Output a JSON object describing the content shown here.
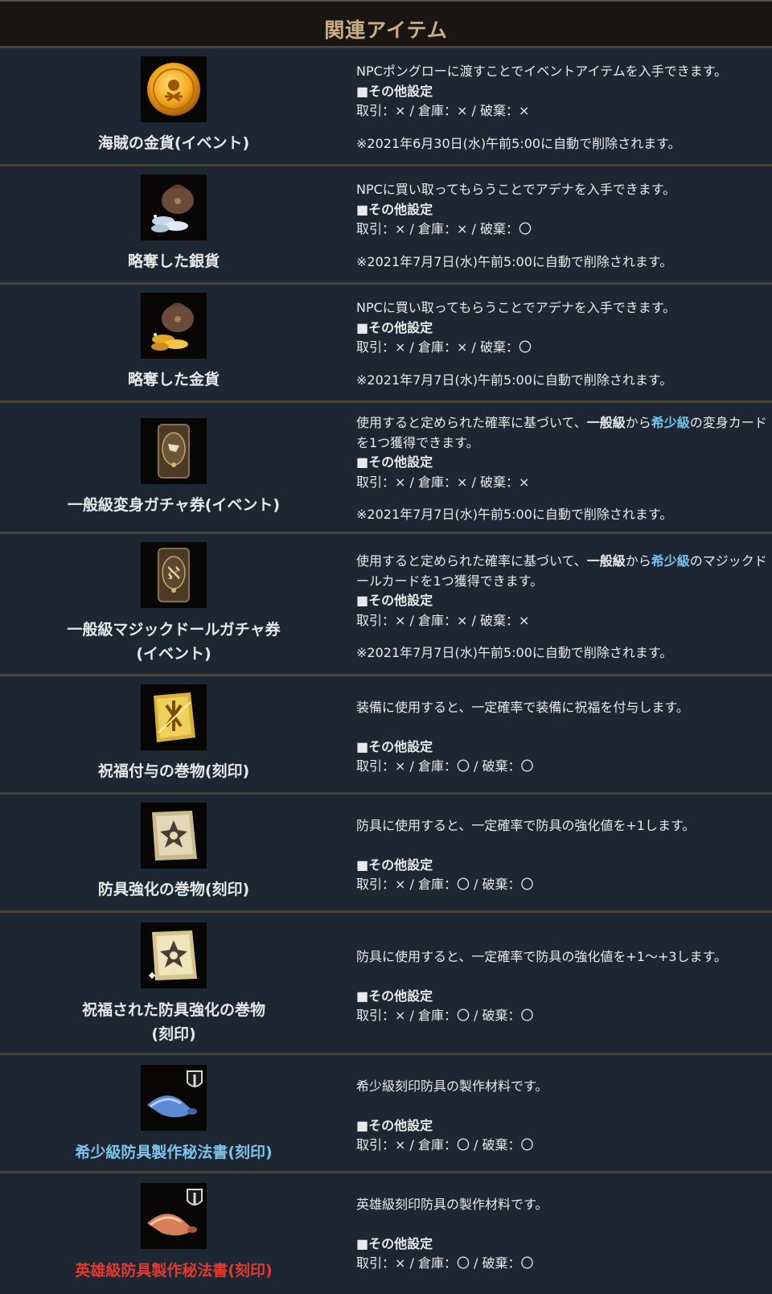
{
  "header": {
    "title": "関連アイテム"
  },
  "settings_heading": "■その他設定",
  "items": [
    {
      "name": "海賊の金貨(イベント)",
      "icon": "gold-coin-icon",
      "desc": "NPCポングローに渡すことでイベントアイテムを入手できます。",
      "settings": "取引：× / 倉庫：× / 破棄：×",
      "note": "※2021年6月30日(水)午前5:00に自動で削除されます。"
    },
    {
      "name": "略奪した銀貨",
      "icon": "silver-coin-bag-icon",
      "desc": "NPCに買い取ってもらうことでアデナを入手できます。",
      "settings": "取引：× / 倉庫：× / 破棄：〇",
      "note": "※2021年7月7日(水)午前5:00に自動で削除されます。"
    },
    {
      "name": "略奪した金貨",
      "icon": "gold-coin-bag-icon",
      "desc": "NPCに買い取ってもらうことでアデナを入手できます。",
      "settings": "取引：× / 倉庫：× / 破棄：〇",
      "note": "※2021年7月7日(水)午前5:00に自動で削除されます。"
    },
    {
      "name": "一般級変身ガチャ券(イベント)",
      "icon": "transform-card-icon",
      "desc_a": "使用すると定められた確率に基づいて、",
      "desc_b": "一般級",
      "desc_c": "から",
      "desc_d": "希少級",
      "desc_e": "の変身カードを1つ獲得できます。",
      "settings": "取引：× / 倉庫：× / 破棄：×",
      "note": "※2021年7月7日(水)午前5:00に自動で削除されます。"
    },
    {
      "name_line1": "一般級マジックドールガチャ券",
      "name_line2": "(イベント)",
      "icon": "magic-doll-card-icon",
      "desc_a": "使用すると定められた確率に基づいて、",
      "desc_b": "一般級",
      "desc_c": "から",
      "desc_d": "希少級",
      "desc_e": "のマジックドールカードを1つ獲得できます。",
      "settings": "取引：× / 倉庫：× / 破棄：×",
      "note": "※2021年7月7日(水)午前5:00に自動で削除されます。"
    },
    {
      "name": "祝福付与の巻物(刻印)",
      "icon": "blessing-scroll-icon",
      "desc": "装備に使用すると、一定確率で装備に祝福を付与します。",
      "settings": "取引：× / 倉庫：〇 / 破棄：〇"
    },
    {
      "name": "防具強化の巻物(刻印)",
      "icon": "armor-enchant-scroll-icon",
      "desc": "防具に使用すると、一定確率で防具の強化値を+1します。",
      "settings": "取引：× / 倉庫：〇 / 破棄：〇"
    },
    {
      "name_line1": "祝福された防具強化の巻物",
      "name_line2": "(刻印)",
      "icon": "blessed-armor-scroll-icon",
      "desc": "防具に使用すると、一定確率で防具の強化値を+1～+3します。",
      "settings": "取引：× / 倉庫：〇 / 破棄：〇"
    },
    {
      "name": "希少級防具製作秘法書(刻印)",
      "icon": "blue-recipe-scroll-icon",
      "name_color": "#7dc3ea",
      "desc": "希少級刻印防具の製作材料です。",
      "settings": "取引：× / 倉庫：〇 / 破棄：〇"
    },
    {
      "name": "英雄級防具製作秘法書(刻印)",
      "icon": "orange-recipe-scroll-icon",
      "name_color": "#e23a2f",
      "desc": "英雄級刻印防具の製作材料です。",
      "settings": "取引：× / 倉庫：〇 / 破棄：〇"
    }
  ]
}
